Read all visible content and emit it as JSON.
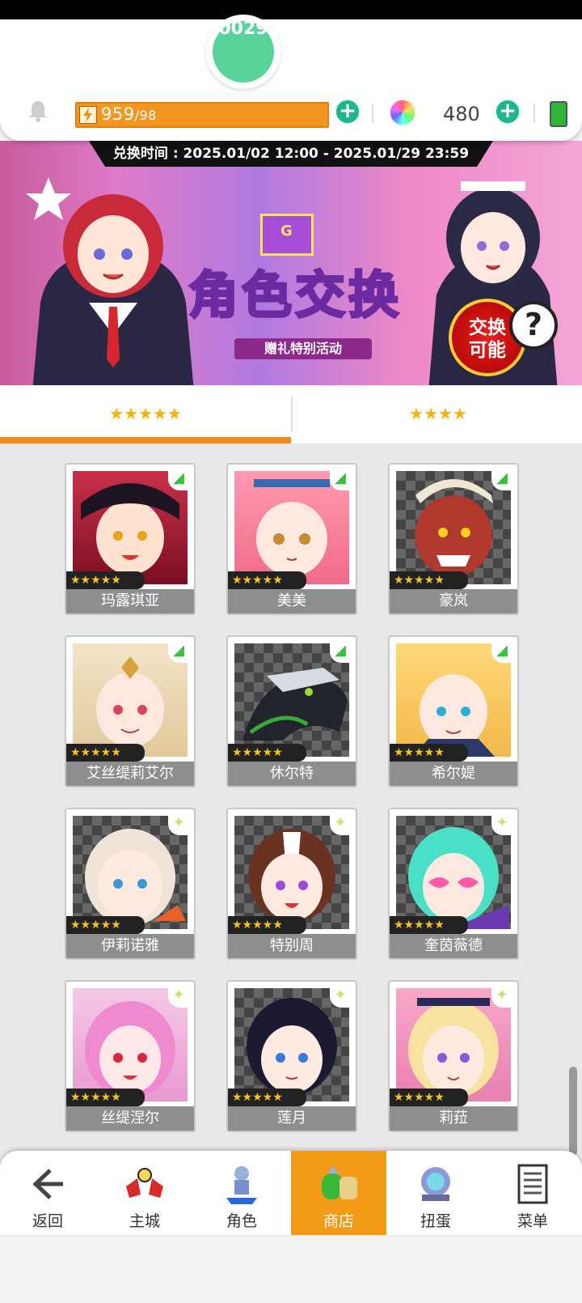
{
  "header": {
    "level_partial": "0029",
    "stamina_current": "959",
    "stamina_max": "/98",
    "gem_count": "480"
  },
  "banner": {
    "date_range": "兑换时间 : 2025.01/02 12:00 - 2025.01/29 23:59",
    "title": "角色交换",
    "subtitle": "赠礼特别活动",
    "badge_line1": "交换",
    "badge_line2": "可能",
    "envelope_letter": "G",
    "help": "?"
  },
  "tabs": [
    {
      "label": "★★★★★"
    },
    {
      "label": "★★★★"
    }
  ],
  "cards": [
    {
      "name": "玛露琪亚",
      "stars": "★★★★★"
    },
    {
      "name": "美美",
      "stars": "★★★★★"
    },
    {
      "name": "豪岚",
      "stars": "★★★★★"
    },
    {
      "name": "艾丝缇莉艾尔",
      "stars": "★★★★★"
    },
    {
      "name": "休尔特",
      "stars": "★★★★★"
    },
    {
      "name": "希尔媞",
      "stars": "★★★★★"
    },
    {
      "name": "伊莉诺雅",
      "stars": "★★★★★"
    },
    {
      "name": "特别周",
      "stars": "★★★★★"
    },
    {
      "name": "奎茵薇德",
      "stars": "★★★★★"
    },
    {
      "name": "丝缇涅尔",
      "stars": "★★★★★"
    },
    {
      "name": "莲月",
      "stars": "★★★★★"
    },
    {
      "name": "莉菈",
      "stars": "★★★★★"
    }
  ],
  "nav": [
    {
      "label": "返回"
    },
    {
      "label": "主城"
    },
    {
      "label": "角色"
    },
    {
      "label": "商店"
    },
    {
      "label": "扭蛋"
    },
    {
      "label": "菜单"
    }
  ],
  "colors": {
    "accent": "#f39a16",
    "stamina": "#f59622",
    "plus": "#1fb58f"
  }
}
